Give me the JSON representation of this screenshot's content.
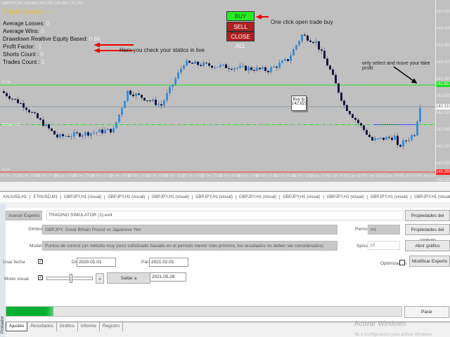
{
  "chart": {
    "header": "GBPJPY,H1  142.813 142.283 142.806 142.211",
    "stats_title": "Trade statics --",
    "stats": [
      {
        "label": "Average Losses:",
        "value": "0"
      },
      {
        "label": "Average Wins:",
        "value": "0"
      },
      {
        "label": "Drawdown Realtive Equity Based:",
        "value": "0.84"
      },
      {
        "label": "Profit Factor:",
        "value": "-1"
      },
      {
        "label": "Shorts Count :",
        "value": "0"
      },
      {
        "label": "Trades Count :",
        "value": "1"
      }
    ],
    "buttons": {
      "buy": "BUY",
      "sell": "SELL",
      "close_all": "CLOSE ALL"
    },
    "notes": {
      "buy": "One click open trade buy",
      "stats": "Here you check your statics in live",
      "tp": "only select and move your take profit"
    },
    "tp_box": {
      "line1": "Buy tp",
      "line2": "142.827"
    },
    "line_labels": {
      "tp": "#1 tp",
      "entry": "#1 buy 0.10",
      "sl": "#1 sl"
    },
    "price_axis": [
      "144.910",
      "144.430",
      "143.950",
      "143.470",
      "142.990",
      "142.510",
      "142.030",
      "141.550",
      "141.070",
      "140.590",
      "140.110"
    ],
    "price_tags": {
      "tp": "142.827",
      "bid": "142.210",
      "sl": "140.350"
    },
    "prices": {
      "top": 144.91,
      "per_tick": 0.48,
      "tp": 142.827,
      "bid": 142.21,
      "entry": 141.7,
      "sl": 140.35
    },
    "path_keypoints": [
      [
        0,
        142.65
      ],
      [
        8,
        142.25
      ],
      [
        20,
        141.35
      ],
      [
        40,
        141.55
      ],
      [
        45,
        142.65
      ],
      [
        57,
        142.25
      ],
      [
        65,
        143.45
      ],
      [
        80,
        143.35
      ],
      [
        95,
        143.25
      ],
      [
        102,
        143.55
      ],
      [
        107,
        144.25
      ],
      [
        112,
        144.05
      ],
      [
        117,
        143.25
      ],
      [
        122,
        142.25
      ],
      [
        127,
        141.75
      ],
      [
        132,
        141.25
      ],
      [
        140,
        141.35
      ],
      [
        141,
        141.05
      ],
      [
        147,
        141.45
      ],
      [
        149,
        142.25
      ]
    ],
    "time_axis": [
      "20 Dec 2019",
      "20 Dec 23:00",
      "23 Dec 07:00",
      "23 Dec 15:00",
      "23 Dec 23:00",
      "24 Dec 07:00",
      "24 Dec 15:00",
      "26 Dec 13:00",
      "26 Dec 21:00",
      "27 Dec 05:00",
      "27 Dec 13:00",
      "27 Dec 21:00",
      "30 Dec 05:00",
      "30 Dec 13:00",
      "30 Dec 21:00",
      "31 Dec 05:00",
      "31 Dec 13:00",
      "2 Jan 10:00",
      "2 Jan 18:00",
      "3 Jan 02:00",
      "3 Jan 10:00",
      "3 Jan 18:00",
      "6 Jan 02:00",
      "6 Jan 10:00"
    ],
    "colors": {
      "bull": "#3a8fd8",
      "bear": "#151540",
      "tp": "#22dd22",
      "sl": "#ff3030",
      "bid": "#8a9aa8"
    }
  },
  "tabs": [
    "XAUUSD,H1",
    "ETHUSD,M1",
    "GBPJPY,H1 (visual)",
    "GBPJPY,H1 (visual)",
    "GBPJPY,H1 (visual)",
    "GBPJPY,H1 (visual)",
    "GBPJPY,H1 (visual)",
    "GBPJPY,H1 (visual)",
    "GBPJPY,H1 (visual)",
    "GBPJPY,H1 (visual)",
    "GBPJPY,H1 (visual)",
    "GBPJPY,H1 (visual)",
    "GBPJPY,H1 (visual)",
    "GBPJPY,H1 ‹ ›"
  ],
  "tester": {
    "type": "Asesor Experto",
    "expert": "TRADING SIMULATOR (1).ex4",
    "expert_props": "Propiedades del experto",
    "symbol_label": "Símbolo:",
    "symbol": "GBPJPY, Great Britain Pound vs Japanese Yen",
    "period_label": "Período:",
    "period": "H1",
    "symbol_props": "Propiedades del símbolo",
    "model_label": "Modelo:",
    "model": "Puntos de control (un método muy poco sofisticado basado en el período menor más próximo, los resultados no deben ser considerados)",
    "spread_label": "Spread:",
    "spread": "10",
    "open_chart": "Abrir gráfico",
    "use_date": "Usar fecha",
    "from_label": "De:",
    "from": "2020.01.01",
    "to_label": "Para:",
    "to": "2021.02.01",
    "optimization": "Optimización",
    "modify_expert": "Modificar Experto",
    "visual_mode": "Modo visual",
    "skip_arrows": "»",
    "skip_to": "Saltar a",
    "skip_date": "2021.05.28",
    "progress": 0.12,
    "stop": "Parar",
    "side": "Probador",
    "bottom_tabs": [
      "Ajustes",
      "Resultados",
      "Gráfico",
      "Informe",
      "Registro"
    ],
    "watermark1": "Activar Windows",
    "watermark2": "Ve a Configuración para activar Windows."
  }
}
